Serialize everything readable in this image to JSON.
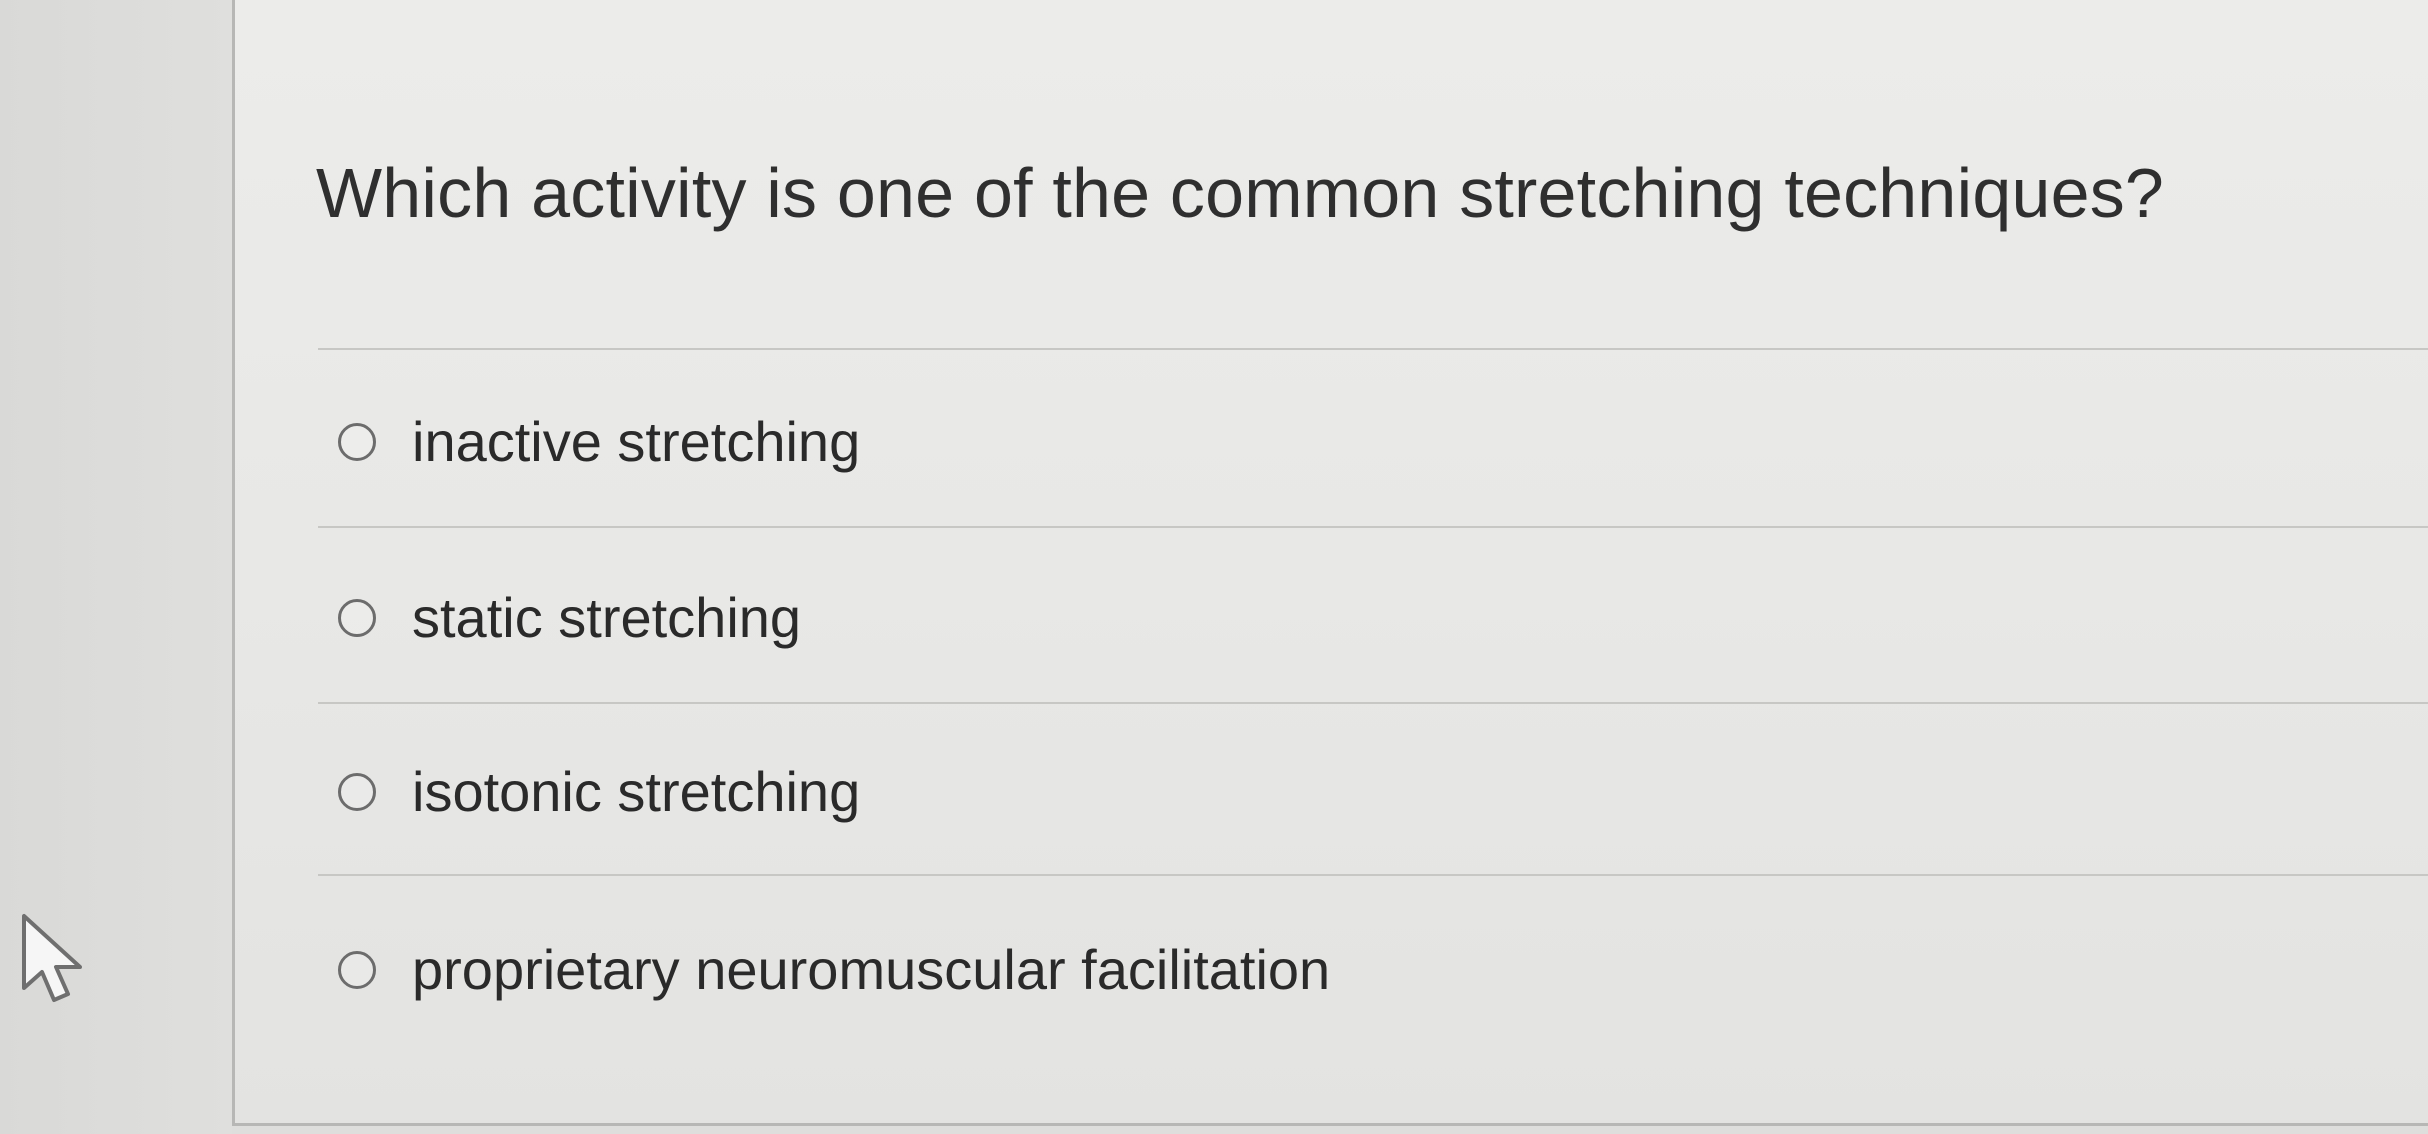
{
  "question": {
    "text": "Which activity is one of the common stretching techniques?"
  },
  "answers": [
    {
      "label": "inactive stretching",
      "selected": false
    },
    {
      "label": "static stretching",
      "selected": false
    },
    {
      "label": "isotonic stretching",
      "selected": false
    },
    {
      "label": "proprietary neuromuscular facilitation",
      "selected": false
    }
  ],
  "icons": {
    "pointer": "mouse-pointer-icon",
    "radio": "radio-circle-icon"
  },
  "colors": {
    "background": "#e7e7e5",
    "border": "#b7b7b5",
    "text": "#2b2b2b",
    "radio_outline": "#6c6c6c",
    "divider": "#c7c7c4"
  }
}
